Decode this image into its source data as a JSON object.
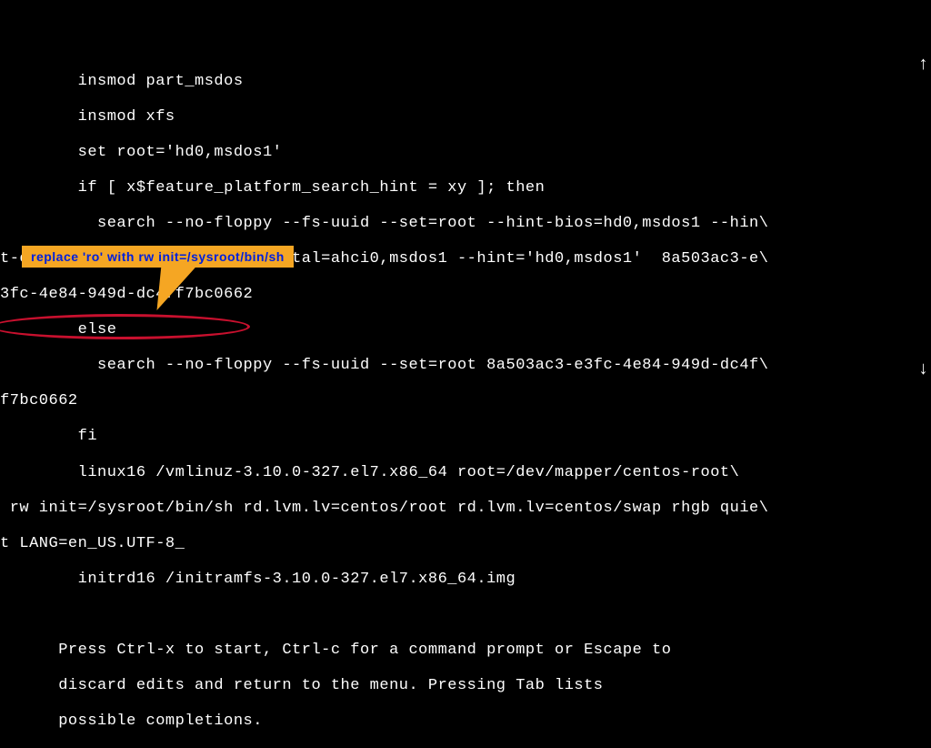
{
  "lines": {
    "l1": "        insmod part_msdos",
    "l2": "        insmod xfs",
    "l3": "        set root='hd0,msdos1'",
    "l4": "        if [ x$feature_platform_search_hint = xy ]; then",
    "l5": "          search --no-floppy --fs-uuid --set=root --hint-bios=hd0,msdos1 --hin\\",
    "l6": "t-efi=hd0,msdos1 --hint-baremetal=ahci0,msdos1 --hint='hd0,msdos1'  8a503ac3-e\\",
    "l7": "3fc-4e84-949d-dc4ff7bc0662",
    "l8": "        else",
    "l9": "          search --no-floppy --fs-uuid --set=root 8a503ac3-e3fc-4e84-949d-dc4f\\",
    "l10": "f7bc0662",
    "l11": "        fi",
    "l12": "        linux16 /vmlinuz-3.10.0-327.el7.x86_64 root=/dev/mapper/centos-root\\",
    "l13": " rw init=/sysroot/bin/sh rd.lvm.lv=centos/root rd.lvm.lv=centos/swap rhgb quie\\",
    "l14": "t LANG=en_US.UTF-8_",
    "l15": "        initrd16 /initramfs-3.10.0-327.el7.x86_64.img",
    "blank": "",
    "l16": "      Press Ctrl-x to start, Ctrl-c for a command prompt or Escape to",
    "l17": "      discard edits and return to the menu. Pressing Tab lists",
    "l18": "      possible completions."
  },
  "callout": {
    "text": "replace 'ro' with rw init=/sysroot/bin/sh"
  },
  "arrows": {
    "up": "↑",
    "down": "↓"
  }
}
